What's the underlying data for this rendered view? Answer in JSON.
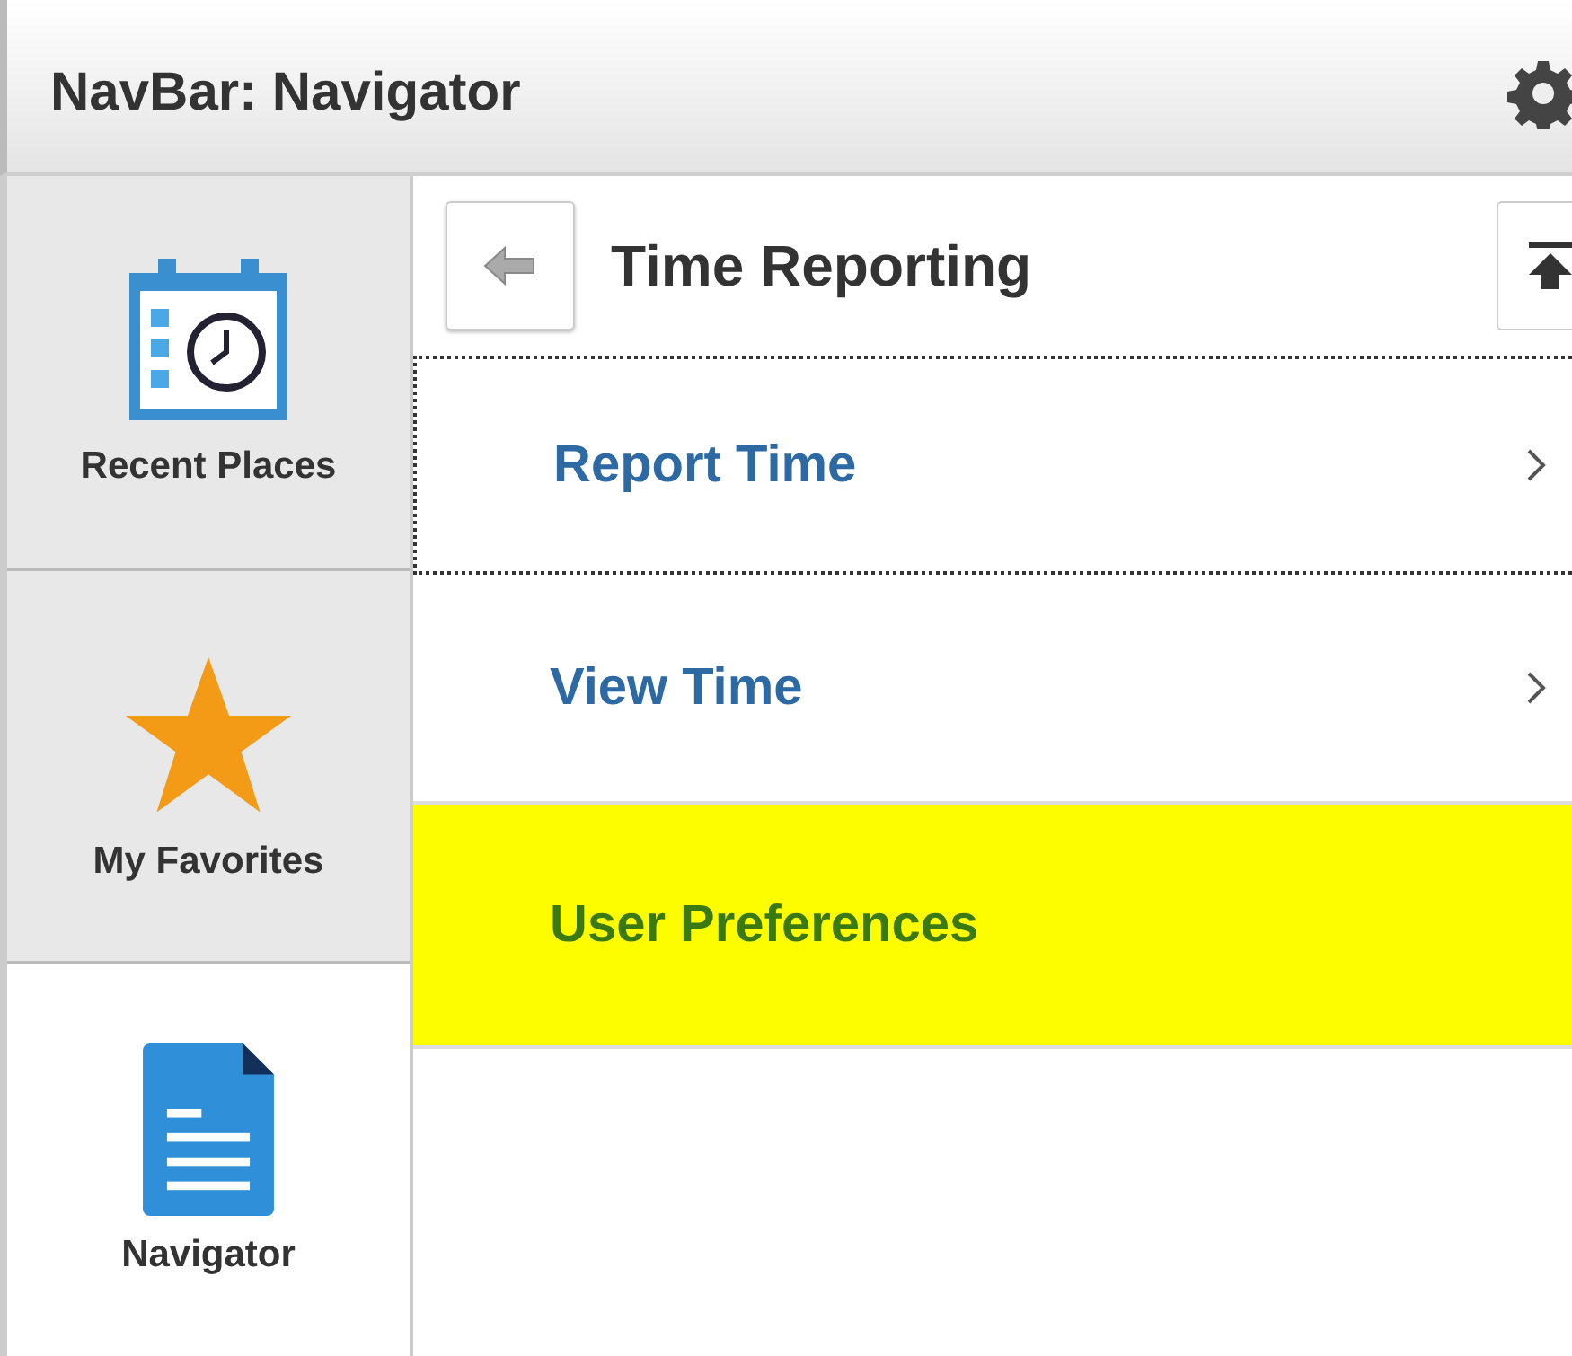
{
  "header": {
    "title": "NavBar: Navigator"
  },
  "sidebar": {
    "items": [
      {
        "label": "Recent Places",
        "kind": "calendar",
        "selected": false
      },
      {
        "label": "My Favorites",
        "kind": "star",
        "selected": false
      },
      {
        "label": "Navigator",
        "kind": "document",
        "selected": true
      }
    ]
  },
  "panel": {
    "title": "Time Reporting",
    "items": [
      {
        "label": "Report Time",
        "focused": true,
        "highlighted": false,
        "has_chevron": true
      },
      {
        "label": "View Time",
        "focused": false,
        "highlighted": false,
        "has_chevron": true
      },
      {
        "label": "User Preferences",
        "focused": false,
        "highlighted": true,
        "has_chevron": false
      }
    ]
  }
}
